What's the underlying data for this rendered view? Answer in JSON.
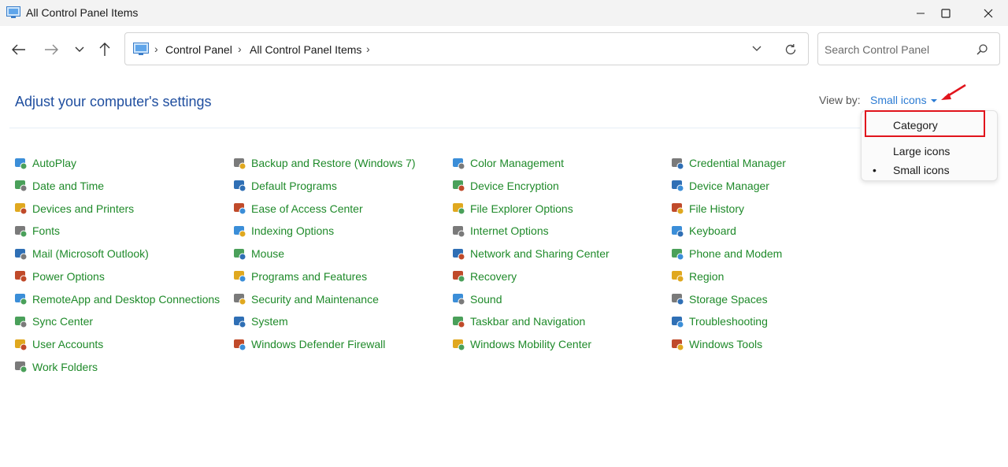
{
  "window": {
    "title": "All Control Panel Items",
    "minimize": "—",
    "maximize": "☐",
    "close": "✕"
  },
  "nav": {
    "back": "←",
    "forward": "→",
    "recent": "⌄",
    "up": "↑",
    "breadcrumb": [
      "Control Panel",
      "All Control Panel Items"
    ],
    "separator": "›",
    "dropdown": "⌄",
    "refresh": "↻"
  },
  "search": {
    "placeholder": "Search Control Panel"
  },
  "heading": "Adjust your computer's settings",
  "viewby": {
    "label": "View by:",
    "selected": "Small icons",
    "options": [
      "Category",
      "Large icons",
      "Small icons"
    ],
    "bullet": "•"
  },
  "columns": [
    [
      "AutoPlay",
      "Date and Time",
      "Devices and Printers",
      "Fonts",
      "Mail (Microsoft Outlook)",
      "Power Options",
      "RemoteApp and Desktop Connections",
      "Sync Center",
      "User Accounts",
      "Work Folders"
    ],
    [
      "Backup and Restore (Windows 7)",
      "Default Programs",
      "Ease of Access Center",
      "Indexing Options",
      "Mouse",
      "Programs and Features",
      "Security and Maintenance",
      "System",
      "Windows Defender Firewall"
    ],
    [
      "Color Management",
      "Device Encryption",
      "File Explorer Options",
      "Internet Options",
      "Network and Sharing Center",
      "Recovery",
      "Sound",
      "Taskbar and Navigation",
      "Windows Mobility Center"
    ],
    [
      "Credential Manager",
      "Device Manager",
      "File History",
      "Keyboard",
      "Phone and Modem",
      "Region",
      "Storage Spaces",
      "Troubleshooting",
      "Windows Tools"
    ]
  ],
  "icon_colors": [
    "#3b8ed8",
    "#4aa05a",
    "#e0a81f",
    "#7a7a7a",
    "#2f6fb5",
    "#c04a2a"
  ],
  "colors": {
    "link": "#1f8a2a",
    "heading": "#1f4e9f",
    "accent": "#2b7bd3",
    "highlight": "#e1141c"
  }
}
